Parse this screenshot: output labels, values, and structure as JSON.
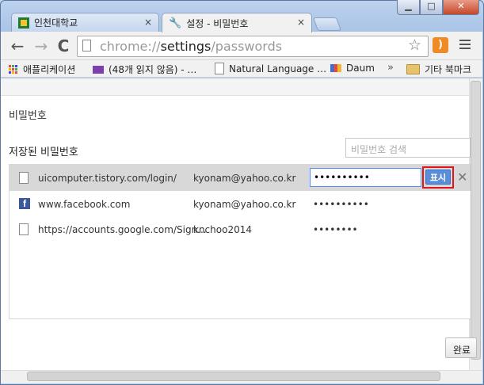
{
  "browser": {
    "tabs": [
      {
        "label": "인천대학교",
        "close": "×"
      },
      {
        "label": "설정 - 비밀번호",
        "close": "×"
      }
    ],
    "window_controls": {
      "min": "▁",
      "max": "□",
      "close": "✕"
    },
    "url": {
      "scheme": "chrome://",
      "host": "settings",
      "path": "/passwords"
    },
    "nav": {
      "back": "←",
      "forward": "→",
      "reload": "C"
    },
    "bookmarks": [
      {
        "label": "애플리케이션",
        "icon": "apps-icon"
      },
      {
        "label": "(48개 읽지 않음) - …",
        "icon": "mail-icon"
      },
      {
        "label": "Natural Language …",
        "icon": "document-icon"
      },
      {
        "label": "Daum",
        "icon": "daum-icon"
      },
      {
        "label": "기타 북마크",
        "icon": "folder-icon"
      }
    ],
    "bookmarks_overflow": "»"
  },
  "page": {
    "heading": "비밀번호",
    "section_title": "저장된 비밀번호",
    "search_placeholder": "비밀번호 검색",
    "rows": [
      {
        "site": "uicomputer.tistory.com/login/",
        "user": "kyonam@yahoo.co.kr",
        "password": "••••••••••",
        "selected": true
      },
      {
        "site": "www.facebook.com",
        "user": "kyonam@yahoo.co.kr",
        "password": "••••••••••",
        "selected": false
      },
      {
        "site": "https://accounts.google.com/Sign...",
        "user": "knchoo2014",
        "password": "••••••••",
        "selected": false
      }
    ],
    "show_button": "표시",
    "remove": "✕",
    "done_button": "완료"
  },
  "colors": {
    "accent": "#4d90fe",
    "highlight_box": "#e0141c",
    "selected_row": "#d8d8d8",
    "frame": "#a9c4e6"
  }
}
